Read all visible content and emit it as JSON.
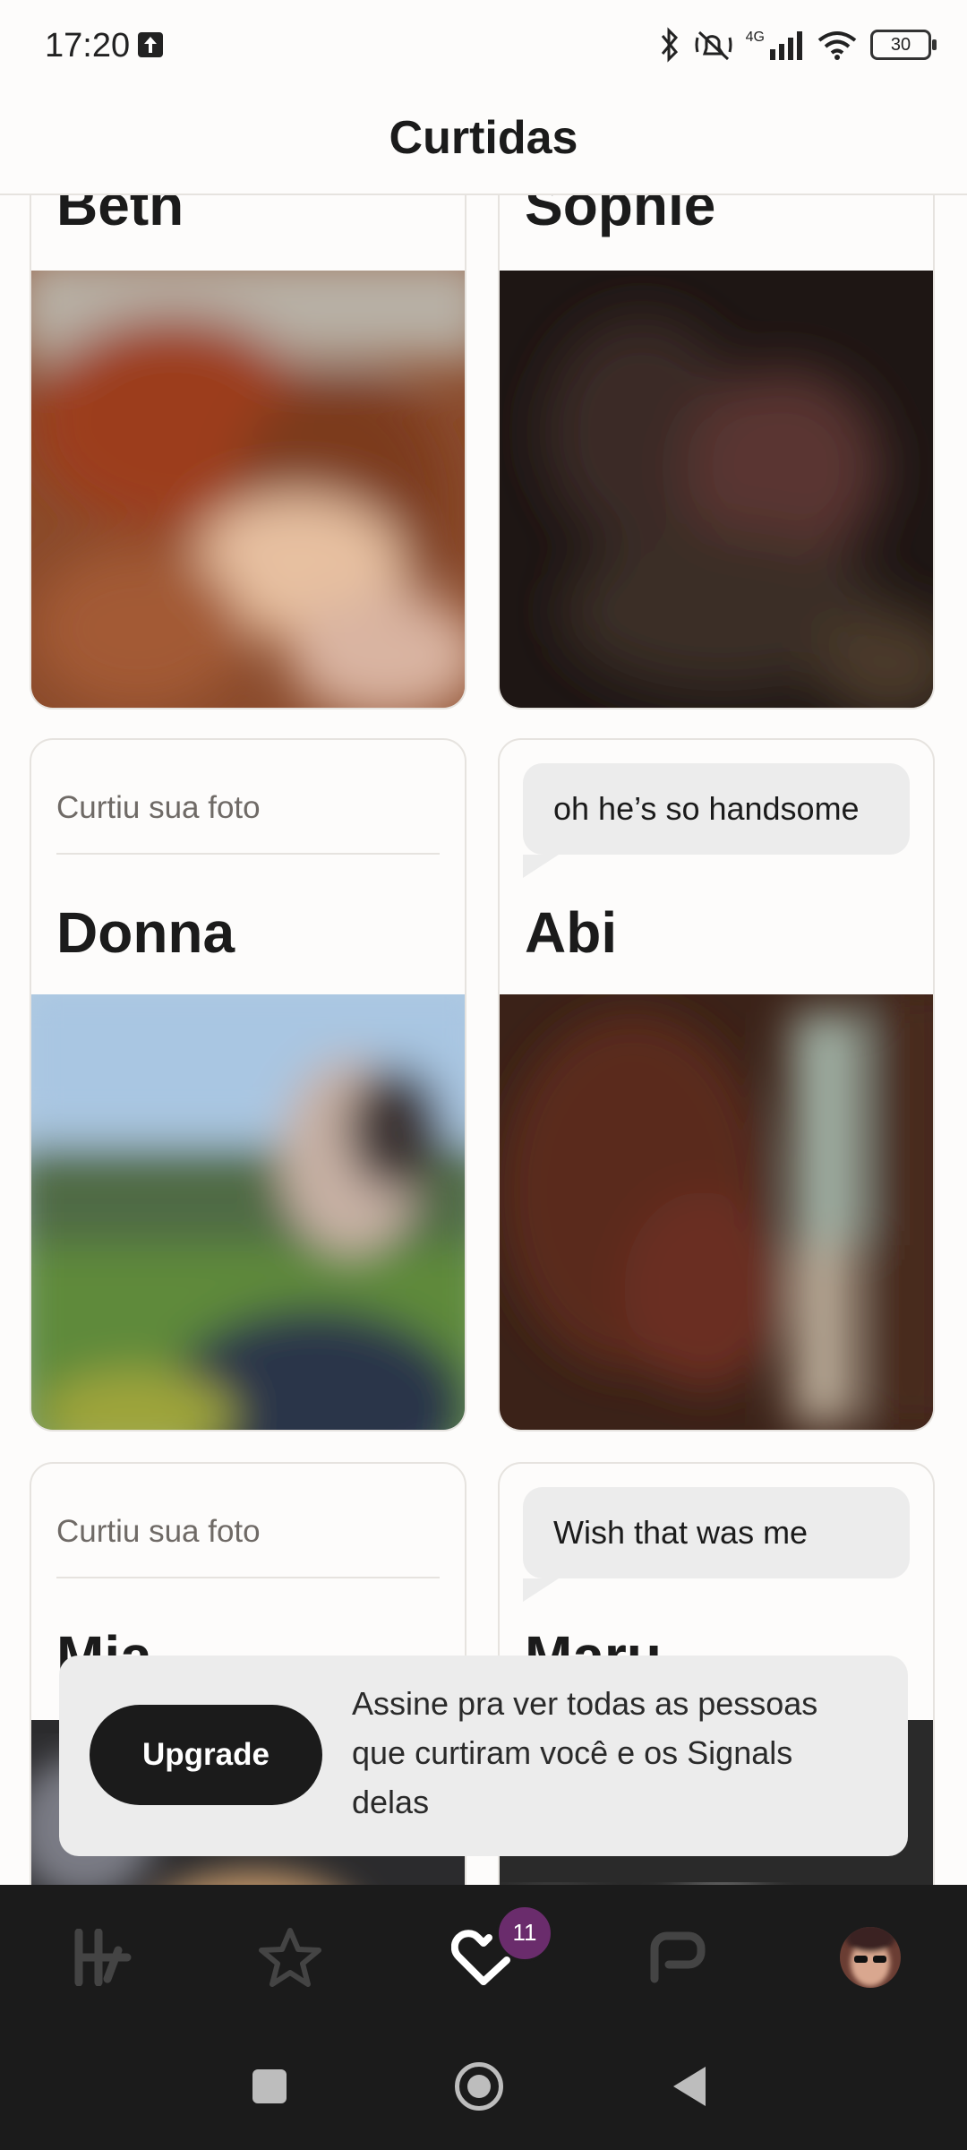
{
  "status_bar": {
    "time": "17:20",
    "network": "4G",
    "battery": "30"
  },
  "header": {
    "title": "Curtidas"
  },
  "cards": [
    {
      "name": "Beth"
    },
    {
      "name": "Sophie"
    },
    {
      "caption": "Curtiu sua foto",
      "name": "Donna"
    },
    {
      "message": "oh he’s so handsome",
      "name": "Abi"
    },
    {
      "caption": "Curtiu sua foto",
      "name": "Mia"
    },
    {
      "message": "Wish that was me",
      "name": "Maru"
    }
  ],
  "upgrade": {
    "button_label": "Upgrade",
    "text": "Assine pra ver todas as pessoas que curtiram você e os Signals delas"
  },
  "bottom_nav": {
    "items": [
      "discover-icon",
      "standouts-icon",
      "likes-icon",
      "chat-icon",
      "profile-avatar"
    ],
    "likes_badge": "11",
    "accent": "#6a2c6c"
  },
  "colors": {
    "background": "#fdfcfb",
    "nav_background": "#1b1b1b",
    "banner": "#ececec"
  }
}
